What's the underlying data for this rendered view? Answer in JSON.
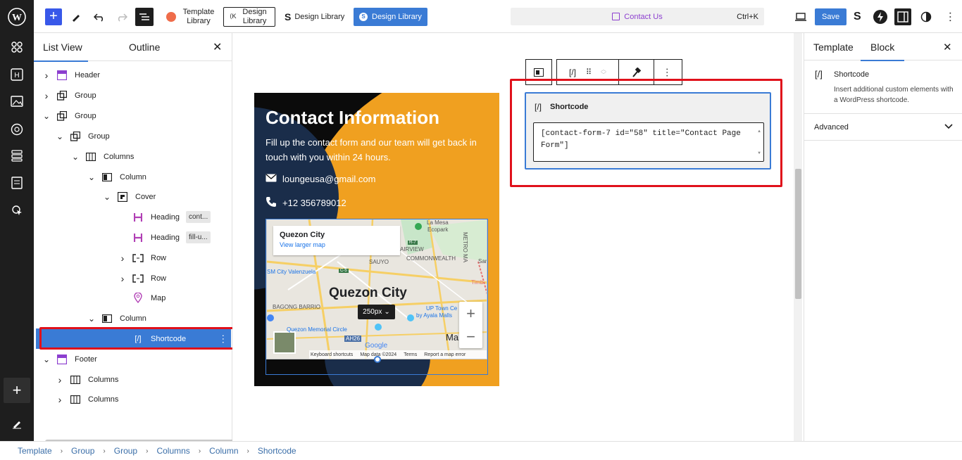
{
  "topbar": {
    "template_library": "Template Library",
    "design_library_outline": "Design Library",
    "design_library_plain": "Design Library",
    "design_library_blue": "Design Library",
    "command": {
      "title": "Contact Us",
      "shortcut": "Ctrl+K"
    },
    "save": "Save"
  },
  "listview": {
    "tabs": [
      "List View",
      "Outline"
    ],
    "items": [
      {
        "label": "Header",
        "icon": "template-part-icon"
      },
      {
        "label": "Group",
        "icon": "group-icon"
      },
      {
        "label": "Group",
        "icon": "group-icon"
      },
      {
        "label": "Group",
        "icon": "group-icon"
      },
      {
        "label": "Columns",
        "icon": "columns-icon"
      },
      {
        "label": "Column",
        "icon": "column-icon"
      },
      {
        "label": "Cover",
        "icon": "cover-icon"
      },
      {
        "label": "Heading",
        "icon": "heading-icon",
        "badge": "cont..."
      },
      {
        "label": "Heading",
        "icon": "heading-icon",
        "badge": "fill-u..."
      },
      {
        "label": "Row",
        "icon": "row-icon"
      },
      {
        "label": "Row",
        "icon": "row-icon"
      },
      {
        "label": "Map",
        "icon": "map-pin-icon"
      },
      {
        "label": "Column",
        "icon": "column-icon"
      },
      {
        "label": "Shortcode",
        "icon": "shortcode-icon"
      },
      {
        "label": "Footer",
        "icon": "template-part-icon"
      },
      {
        "label": "Columns",
        "icon": "columns-icon"
      },
      {
        "label": "Columns",
        "icon": "columns-icon"
      }
    ]
  },
  "canvas": {
    "contact_title": "Contact Information",
    "contact_sub": "Fill up the contact form and our team will get back in touch with you within 24 hours.",
    "email": "loungeusa@gmail.com",
    "phone": "+12 356789012",
    "map": {
      "card_title": "Quezon City",
      "card_link": "View larger map",
      "city_label": "Quezon City",
      "labels": [
        "La Mesa",
        "Ecopark",
        "METRO MA",
        "AIRVIEW",
        "SAUYO",
        "COMMONWEALTH",
        "SM City Valenzuela",
        "Timb",
        "BAGONG BARRIO",
        "UP Town Ce",
        "by Ayala Malls",
        "Quezon Memorial Circle",
        "Ma",
        "AH26",
        "Google",
        "R-7",
        "C-5",
        "Sar"
      ],
      "footer": [
        "Keyboard shortcuts",
        "Map data ©2024",
        "Terms",
        "Report a map error"
      ],
      "size_pill": "250px"
    },
    "shortcode": {
      "title": "Shortcode",
      "value": "[contact-form-7 id=\"58\" title=\"Contact Page Form\"]"
    }
  },
  "settings": {
    "tabs": [
      "Template",
      "Block"
    ],
    "block_name": "Shortcode",
    "block_desc": "Insert additional custom elements with a WordPress shortcode.",
    "advanced": "Advanced"
  },
  "breadcrumbs": [
    "Template",
    "Group",
    "Group",
    "Columns",
    "Column",
    "Shortcode"
  ],
  "colors": {
    "accent": "#3a7bd5",
    "highlight": "#e0111b",
    "orange": "#f0a020"
  }
}
